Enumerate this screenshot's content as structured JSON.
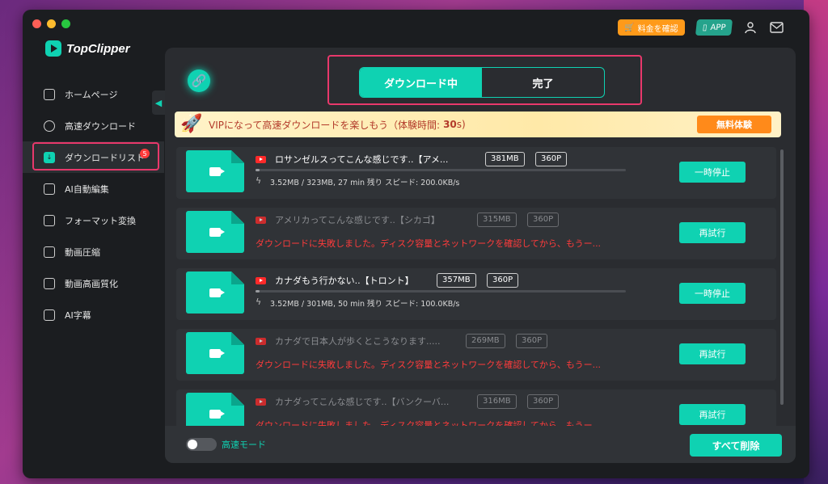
{
  "app": {
    "name": "TopClipper"
  },
  "topbar": {
    "price_label": "料金を確認",
    "app_label": "APP",
    "user_icon": "user-icon",
    "mail_icon": "mail-icon"
  },
  "sidebar": {
    "items": [
      {
        "label": "ホームページ",
        "icon": "home-icon"
      },
      {
        "label": "高速ダウンロード",
        "icon": "search-icon"
      },
      {
        "label": "ダウンロードリスト",
        "icon": "download-icon",
        "badge": "5",
        "active": true
      },
      {
        "label": "AI自動編集",
        "icon": "ai-edit-icon"
      },
      {
        "label": "フォーマット変換",
        "icon": "convert-icon"
      },
      {
        "label": "動画圧縮",
        "icon": "compress-icon"
      },
      {
        "label": "動画高画質化",
        "icon": "hd-icon"
      },
      {
        "label": "AI字幕",
        "icon": "subtitle-icon"
      }
    ]
  },
  "tabs": [
    {
      "label": "ダウンロード中",
      "active": true
    },
    {
      "label": "完了",
      "active": false
    }
  ],
  "vip": {
    "text": "VIPになって高速ダウンロードを楽しもう（体験時間:",
    "time_value": "30",
    "time_unit": "s)",
    "button": "無料体験"
  },
  "downloads": [
    {
      "title": "ロサンゼルスってこんな感じです..【アメ...",
      "size": "381MB",
      "quality": "360P",
      "status": "downloading",
      "progress": 0.01,
      "stats": "3.52MB / 323MB, 27 min 残り  スピード: 200.0KB/s",
      "action": "一時停止"
    },
    {
      "title": "アメリカってこんな感じです..【シカゴ】",
      "size": "315MB",
      "quality": "360P",
      "status": "failed",
      "error": "ダウンロードに失敗しました。ディスク容量とネットワークを確認してから、もうー...",
      "action": "再試行"
    },
    {
      "title": "カナダもう行かない..【トロント】",
      "size": "357MB",
      "quality": "360P",
      "status": "downloading",
      "progress": 0.01,
      "stats": "3.52MB / 301MB, 50 min 残り  スピード: 100.0KB/s",
      "action": "一時停止"
    },
    {
      "title": "カナダで日本人が歩くとこうなります.....",
      "size": "269MB",
      "quality": "360P",
      "status": "failed",
      "error": "ダウンロードに失敗しました。ディスク容量とネットワークを確認してから、もうー...",
      "action": "再試行"
    },
    {
      "title": "カナダってこんな感じです..【バンクーバ...",
      "size": "316MB",
      "quality": "360P",
      "status": "failed",
      "error": "ダウンロードに失敗しました。ディスク容量とネットワークを確認してから、もうー...",
      "action": "再試行"
    }
  ],
  "footer": {
    "toggle_label": "高速モード",
    "toggle_on": false,
    "delete_all": "すべて削除"
  },
  "colors": {
    "accent": "#0fd2b2",
    "error": "#ff3b3b",
    "highlight": "#e8386b",
    "vip_button": "#ff8a1a"
  }
}
